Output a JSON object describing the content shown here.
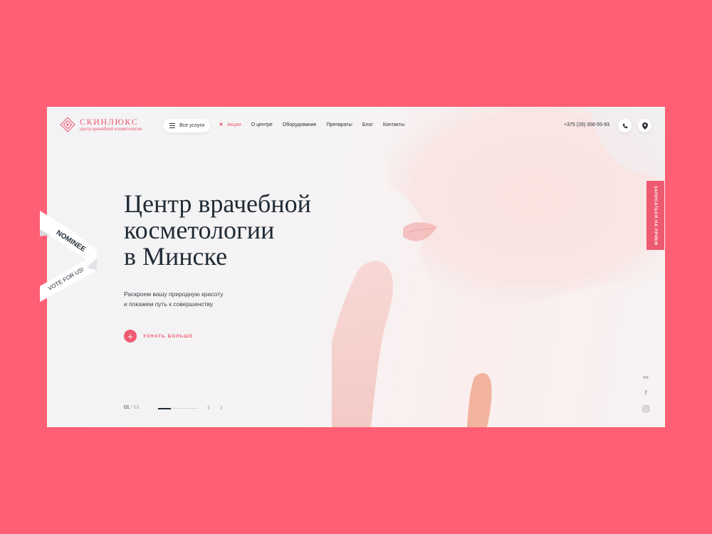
{
  "header": {
    "logo": {
      "name": "СКИНЛЮКС",
      "tagline": "центр врачебной косметологии"
    },
    "all_services_label": "Все услуги",
    "nav": [
      {
        "label": "Акции",
        "icon": "star-icon",
        "active": true
      },
      {
        "label": "О центре"
      },
      {
        "label": "Оборудование"
      },
      {
        "label": "Препараты"
      },
      {
        "label": "Блог"
      },
      {
        "label": "Контакты"
      }
    ],
    "phone": "+375 (29) 356-55-93",
    "call_icon": "phone-icon",
    "location_icon": "map-pin-icon"
  },
  "hero": {
    "title_lines": [
      "Центр врачебной",
      "косметологии",
      "в Минске"
    ],
    "subtitle_lines": [
      "Раскроем вашу природную красоту",
      "и покажем путь к совершенству"
    ],
    "cta_label": "УЗНАТЬ БОЛЬШЕ",
    "cta_icon": "plus-icon"
  },
  "slider": {
    "current": "01",
    "separator": "/",
    "total": "03",
    "progress": 0.33,
    "prev_icon": "chevron-left-icon",
    "next_icon": "chevron-right-icon"
  },
  "social": {
    "vk": "вк",
    "facebook": "f",
    "instagram_icon": "instagram-icon"
  },
  "booking_label": "ЗАПИСАТЬСЯ НА ПРИЕМ",
  "badge": {
    "nominee": "NOMINEE",
    "vote": "VOTE FOR US!"
  },
  "colors": {
    "brand": "#ee5a70",
    "background": "#ff5f74",
    "text": "#1f2a35"
  }
}
